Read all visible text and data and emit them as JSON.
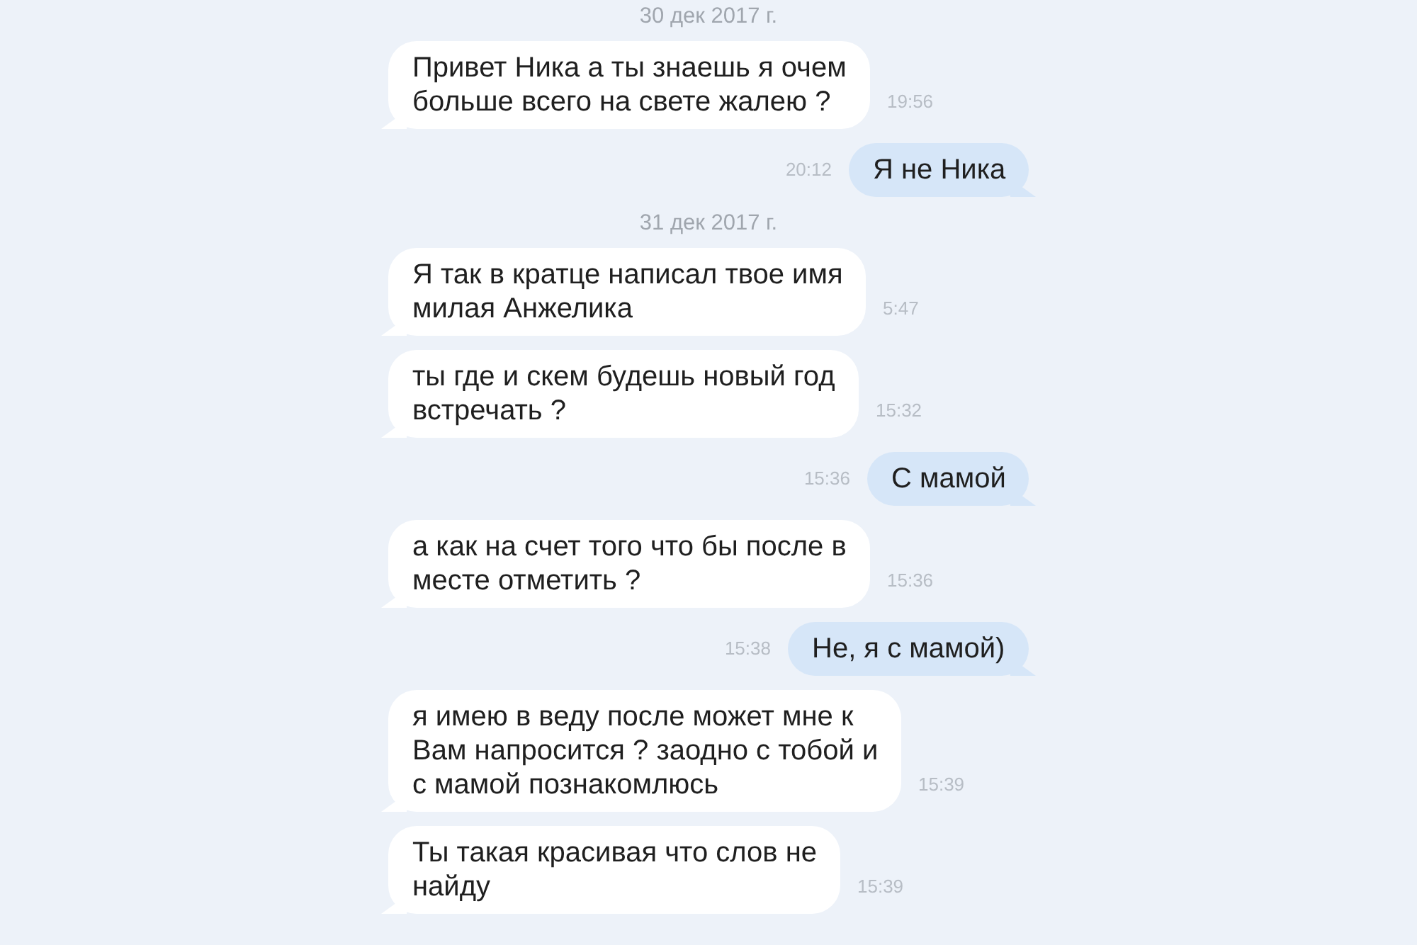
{
  "messages": [
    {
      "kind": "date",
      "text": "30 дек 2017 г."
    },
    {
      "kind": "incoming",
      "text": "Привет Ника а ты знаешь я очем больше всего на свете жалею ?",
      "time": "19:56"
    },
    {
      "kind": "outgoing",
      "text": "Я не Ника",
      "time": "20:12"
    },
    {
      "kind": "date",
      "text": "31 дек 2017 г."
    },
    {
      "kind": "incoming",
      "text": "Я так в кратце написал твое имя милая Анжелика",
      "time": "5:47"
    },
    {
      "kind": "incoming",
      "text": "ты где и скем будешь новый год встречать ?",
      "time": "15:32"
    },
    {
      "kind": "outgoing",
      "text": "С мамой",
      "time": "15:36"
    },
    {
      "kind": "incoming",
      "text": "а как на счет того что бы после в месте отметить ?",
      "time": "15:36"
    },
    {
      "kind": "outgoing",
      "text": "Не, я с мамой)",
      "time": "15:38"
    },
    {
      "kind": "incoming",
      "text": "я имею в веду после может мне к Вам напросится ? заодно с тобой и с мамой познакомлюсь",
      "time": "15:39"
    },
    {
      "kind": "incoming",
      "text": "Ты такая красивая что слов не найду",
      "time": "15:39"
    }
  ]
}
